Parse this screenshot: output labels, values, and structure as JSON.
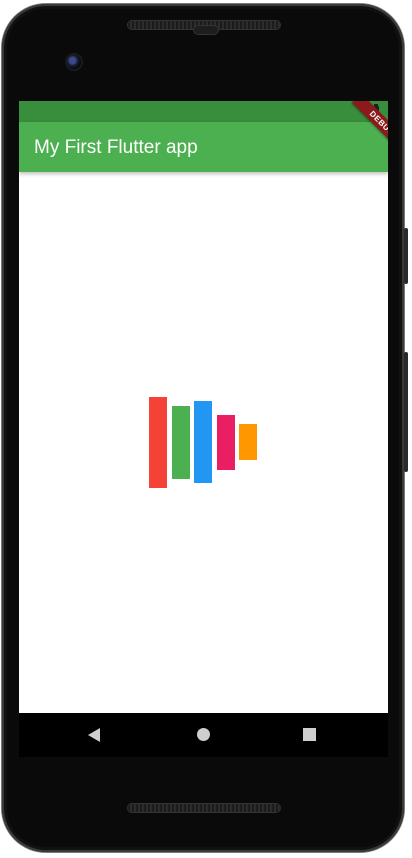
{
  "app_bar": {
    "title": "My First Flutter app",
    "background": "#4caf50",
    "status_bar_color": "#388e3c"
  },
  "debug_banner": {
    "label": "DEBUG"
  },
  "logo_bars": [
    {
      "color": "#f44336"
    },
    {
      "color": "#4caf50"
    },
    {
      "color": "#2196f3"
    },
    {
      "color": "#e91e63"
    },
    {
      "color": "#ff9800"
    }
  ],
  "nav_bar": {
    "icons": [
      "back-icon",
      "home-icon",
      "recents-icon"
    ]
  }
}
